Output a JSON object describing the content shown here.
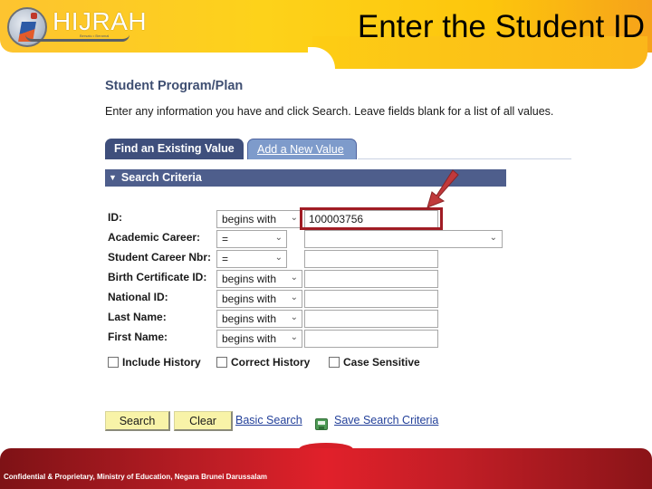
{
  "slide": {
    "title": "Enter the Student ID",
    "logo_text": "HIJRAH",
    "logo_tagline": "Bersatu • Beramal",
    "footer": "Confidential & Proprietary, Ministry of Education, Negara Brunei Darussalam"
  },
  "page": {
    "title": "Student Program/Plan",
    "instructions": "Enter any information you have and click Search. Leave fields blank for a list of all values."
  },
  "tabs": [
    {
      "label": "Find an Existing Value",
      "active": true
    },
    {
      "label": "Add a New Value",
      "active": false
    }
  ],
  "search_criteria": {
    "header": "Search Criteria",
    "fields": [
      {
        "label": "ID:",
        "operator": "begins with",
        "value": ""
      },
      {
        "label": "Academic Career:",
        "operator": "=",
        "value": ""
      },
      {
        "label": "Student Career Nbr:",
        "operator": "=",
        "value": ""
      },
      {
        "label": "Birth Certificate ID:",
        "operator": "begins with",
        "value": ""
      },
      {
        "label": "National ID:",
        "operator": "begins with",
        "value": ""
      },
      {
        "label": "Last Name:",
        "operator": "begins with",
        "value": ""
      },
      {
        "label": "First Name:",
        "operator": "begins with",
        "value": ""
      }
    ],
    "id_value": "100003756",
    "checkboxes": [
      {
        "label": "Include History",
        "checked": false
      },
      {
        "label": "Correct History",
        "checked": false
      },
      {
        "label": "Case Sensitive",
        "checked": false
      }
    ]
  },
  "actions": {
    "search": "Search",
    "clear": "Clear",
    "basic_search": "Basic Search",
    "save_search": "Save Search Criteria"
  },
  "icons": {
    "chevron": "⌄",
    "triangle": "▼"
  },
  "colors": {
    "header_yellow": "#fdd21a",
    "tab_active": "#3f4f7c",
    "tab_inactive": "#7e9bcb",
    "criteria_bar": "#4e5e8c",
    "highlight": "#a01c24",
    "button": "#f8f3a8",
    "link": "#24419a",
    "footer_red": "#e1202a"
  }
}
